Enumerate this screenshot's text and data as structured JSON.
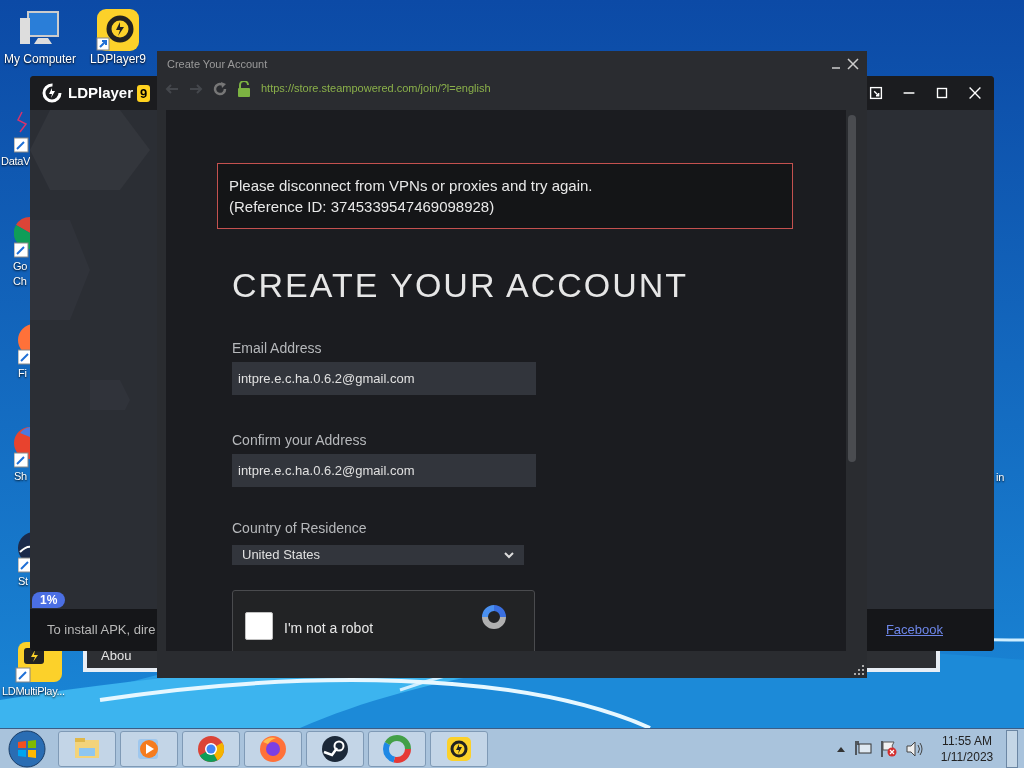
{
  "desktop_icons": [
    {
      "kind": "computer",
      "label": [
        "My Computer"
      ]
    },
    {
      "kind": "ldplayer",
      "label": [
        "LDPlayer9"
      ]
    },
    {
      "kind": "chart",
      "label": [
        "DataV"
      ]
    },
    {
      "kind": "chrome",
      "label": [
        "Go",
        "Ch"
      ]
    },
    {
      "kind": "firefox",
      "label": [
        "Fi"
      ]
    },
    {
      "kind": "shield",
      "label": [
        "Sh"
      ]
    },
    {
      "kind": "dark",
      "label": [
        "St"
      ]
    },
    {
      "kind": "multi",
      "label": [
        "LDMultiPlay..."
      ]
    },
    {
      "kind": "hidden",
      "label": [
        "in"
      ]
    }
  ],
  "ldplayer_window": {
    "title": "LDPlayer",
    "badge": "9",
    "progress": "1%",
    "notice": "To install APK, dire",
    "link": "Facebook"
  },
  "background_window": {
    "title": "Abou"
  },
  "browser_window": {
    "title": "Create Your Account",
    "url": "https://store.steampowered.com/join/?l=english",
    "error": [
      "Please disconnect from VPNs or proxies and try again.",
      "(Reference ID: 3745339547469098928)"
    ],
    "heading": "CREATE YOUR ACCOUNT",
    "fields": [
      {
        "label": "Email Address",
        "value": "intpre.e.c.ha.0.6.2@gmail.com"
      },
      {
        "label": "Confirm your Address",
        "value": "intpre.e.c.ha.0.6.2@gmail.com"
      }
    ],
    "country": {
      "label": "Country of Residence",
      "value": "United States"
    },
    "captcha": {
      "label": "I'm not a robot",
      "checked": false
    }
  },
  "taskbar": {
    "apps": [
      {
        "kind": "folder"
      },
      {
        "kind": "media"
      },
      {
        "kind": "chrome"
      },
      {
        "kind": "firefox"
      },
      {
        "kind": "steam"
      },
      {
        "kind": "ring"
      },
      {
        "kind": "ldplayer"
      }
    ],
    "time": "11:55 AM",
    "date": "1/11/2023"
  }
}
